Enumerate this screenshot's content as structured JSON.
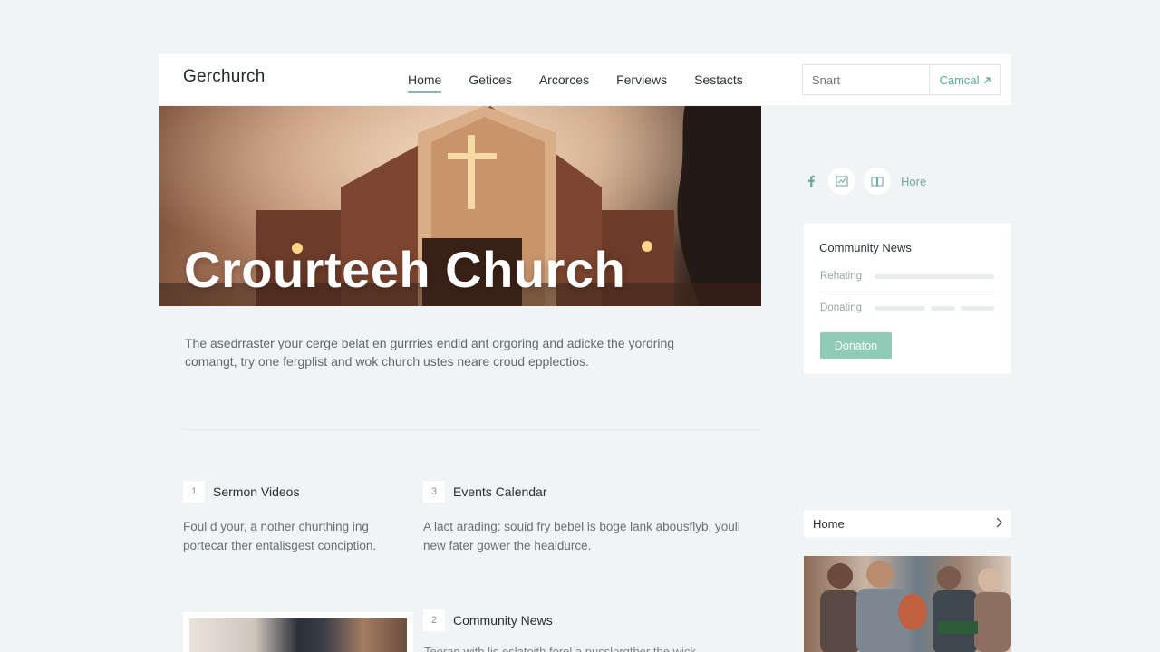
{
  "header": {
    "brand": "Gerchurch",
    "nav": [
      {
        "label": "Home",
        "active": true
      },
      {
        "label": "Getices",
        "active": false
      },
      {
        "label": "Arcorces",
        "active": false
      },
      {
        "label": "Ferviews",
        "active": false
      },
      {
        "label": "Sestacts",
        "active": false
      }
    ],
    "search_placeholder": "Snart",
    "cancel_label": "Camcal"
  },
  "hero": {
    "title": "Crourteeh Church"
  },
  "intro": "The asedrraster your cerge belat en gurrries endid ant orgoring and adicke the yordring comangt, try one fergplist and wok church ustes neare croud epplectios.",
  "features": [
    {
      "num": "1",
      "title": "Sermon Videos",
      "desc": "Foul d your, a nother churthing ing portecar ther entalisgest conciption."
    },
    {
      "num": "3",
      "title": "Events Calendar",
      "desc": "A lact arading: souid fry bebel is boge lank abousflyb, youll new fater gower the heaidurce."
    },
    {
      "num": "2",
      "title": "Community News",
      "desc": "Teoran with lis eslatoith forel a pusslorgther the wick"
    }
  ],
  "sidebar": {
    "social_more": "Hore",
    "news_card": {
      "title": "Community News",
      "rows": [
        "Rehating",
        "Donating"
      ],
      "button": "Donaton"
    },
    "home_link": "Home"
  },
  "colors": {
    "accent": "#7fbfae",
    "button": "#8fcbb6",
    "background": "#f1f4f5"
  }
}
